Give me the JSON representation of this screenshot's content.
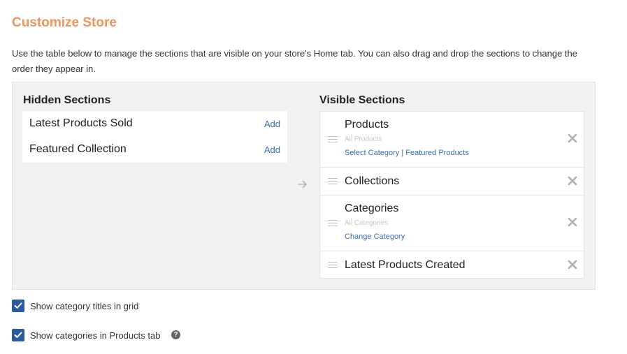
{
  "page": {
    "title": "Customize Store",
    "intro": "Use the table below to manage the sections that are visible on your store's Home tab. You can also drag and drop the sections to change the order they appear in."
  },
  "hidden_sections": {
    "title": "Hidden Sections",
    "items": [
      {
        "label": "Latest Products Sold",
        "action": "Add"
      },
      {
        "label": "Featured Collection",
        "action": "Add"
      }
    ]
  },
  "visible_sections": {
    "title": "Visible Sections",
    "items": [
      {
        "label": "Products",
        "sub": "All Products",
        "link1": "Select Category",
        "separator": "|",
        "link2": "Featured Products"
      },
      {
        "label": "Collections"
      },
      {
        "label": "Categories",
        "sub": "All Categories",
        "link1": "Change Category"
      },
      {
        "label": "Latest Products Created"
      }
    ]
  },
  "options": {
    "show_category_titles": {
      "label": "Show category titles in grid",
      "checked": true
    },
    "show_categories_in_products": {
      "label": "Show categories in Products tab",
      "checked": true,
      "help": "?"
    }
  },
  "colors": {
    "title": "#f0955c",
    "link": "#3a6fb0",
    "checkbox": "#2a5a9f",
    "panel_bg": "#f2f2f2"
  },
  "icons": {
    "arrow": "arrow-right-icon",
    "remove": "close-icon",
    "drag": "drag-handle-icon",
    "check": "check-icon",
    "help": "help-icon"
  }
}
